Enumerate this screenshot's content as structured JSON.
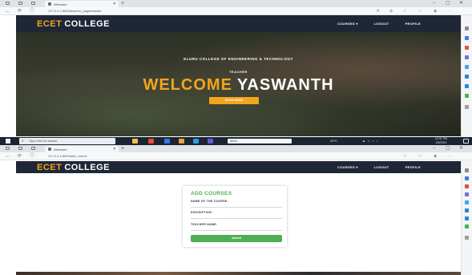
{
  "top": {
    "browser": {
      "tab_title": "Welcome",
      "url": "127.0.0.1:8000/teacher_page/teacher"
    },
    "navbar": {
      "brand_part1": "ECET",
      "brand_part2": "COLLEGE",
      "links": [
        "COURSES ▾",
        "LOGOUT",
        "PROFILE"
      ]
    },
    "hero": {
      "college_name": "ELURU COLLEGE OF ENGINEERING & TECHNOLOGY",
      "role": "TEACHER",
      "welcome_word": "WELCOME",
      "user_name": "YASWANTH",
      "button_label": "KNOW MORE"
    },
    "taskbar": {
      "search_placeholder": "Type here to search",
      "weather": "Alerts",
      "temperature": "29°C",
      "time": "12:37 PM",
      "date": "4/6/2024"
    }
  },
  "bottom": {
    "browser": {
      "tab_title": "Welcome",
      "url": "127.0.0.1:8000/add_course"
    },
    "navbar": {
      "brand_part1": "ECET",
      "brand_part2": "COLLEGE",
      "links": [
        "COURSES ▾",
        "LOGOUT",
        "PROFILE"
      ]
    },
    "form": {
      "title": "ADD COURSES",
      "labels": [
        "NAME OF THE COURSE:",
        "DISCRIPTION:",
        "TEACHER NAME:"
      ],
      "submit_label": "Submit"
    }
  },
  "colors": {
    "brand_orange": "#f3a51e",
    "navbar_bg": "#1f2737",
    "form_green": "#4caf50"
  }
}
